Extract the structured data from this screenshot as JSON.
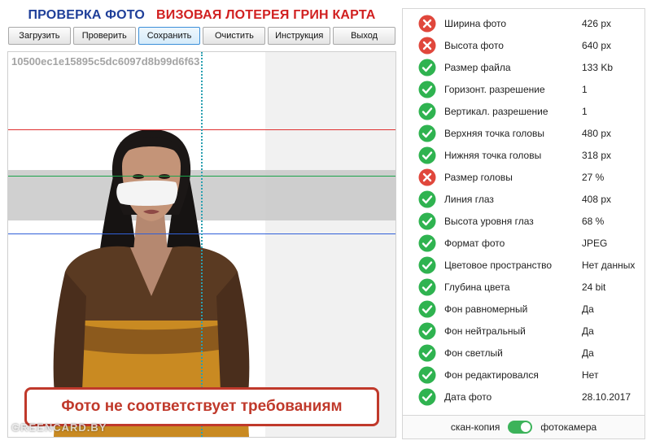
{
  "header": {
    "title_left": "ПРОВЕРКА ФОТО",
    "title_right": "ВИЗОВАЯ ЛОТЕРЕЯ ГРИН КАРТА"
  },
  "toolbar": {
    "load": "Загрузить",
    "check": "Проверить",
    "save": "Сохранить",
    "clear": "Очистить",
    "help": "Инструкция",
    "exit": "Выход"
  },
  "photo": {
    "hash": "10500ec1e15895c5dc6097d8b99d6f63",
    "verdict": "Фото не соответствует требованиям",
    "watermark": "GREENCARD.BY"
  },
  "colors": {
    "pass": "#2fb350",
    "fail": "#e0473c"
  },
  "checks": [
    {
      "status": "fail",
      "label": "Ширина фото",
      "value": "426 px"
    },
    {
      "status": "fail",
      "label": "Высота фото",
      "value": "640 px"
    },
    {
      "status": "pass",
      "label": "Размер файла",
      "value": "133 Kb"
    },
    {
      "status": "pass",
      "label": "Горизонт. разрешение",
      "value": "1"
    },
    {
      "status": "pass",
      "label": "Вертикал. разрешение",
      "value": "1"
    },
    {
      "status": "pass",
      "label": "Верхняя точка головы",
      "value": "480 px"
    },
    {
      "status": "pass",
      "label": "Нижняя точка головы",
      "value": "318 px"
    },
    {
      "status": "fail",
      "label": "Размер головы",
      "value": "27 %"
    },
    {
      "status": "pass",
      "label": "Линия глаз",
      "value": "408 px"
    },
    {
      "status": "pass",
      "label": "Высота уровня глаз",
      "value": "68 %"
    },
    {
      "status": "pass",
      "label": "Формат фото",
      "value": "JPEG"
    },
    {
      "status": "pass",
      "label": "Цветовое пространство",
      "value": "Нет данных"
    },
    {
      "status": "pass",
      "label": "Глубина цвета",
      "value": "24 bit"
    },
    {
      "status": "pass",
      "label": "Фон равномерный",
      "value": "Да"
    },
    {
      "status": "pass",
      "label": "Фон нейтральный",
      "value": "Да"
    },
    {
      "status": "pass",
      "label": "Фон светлый",
      "value": "Да"
    },
    {
      "status": "pass",
      "label": "Фон редактировался",
      "value": "Нет"
    },
    {
      "status": "pass",
      "label": "Дата фото",
      "value": "28.10.2017"
    }
  ],
  "toggle": {
    "left_label": "скан-копия",
    "right_label": "фотокамера",
    "state": "фотокамера"
  }
}
